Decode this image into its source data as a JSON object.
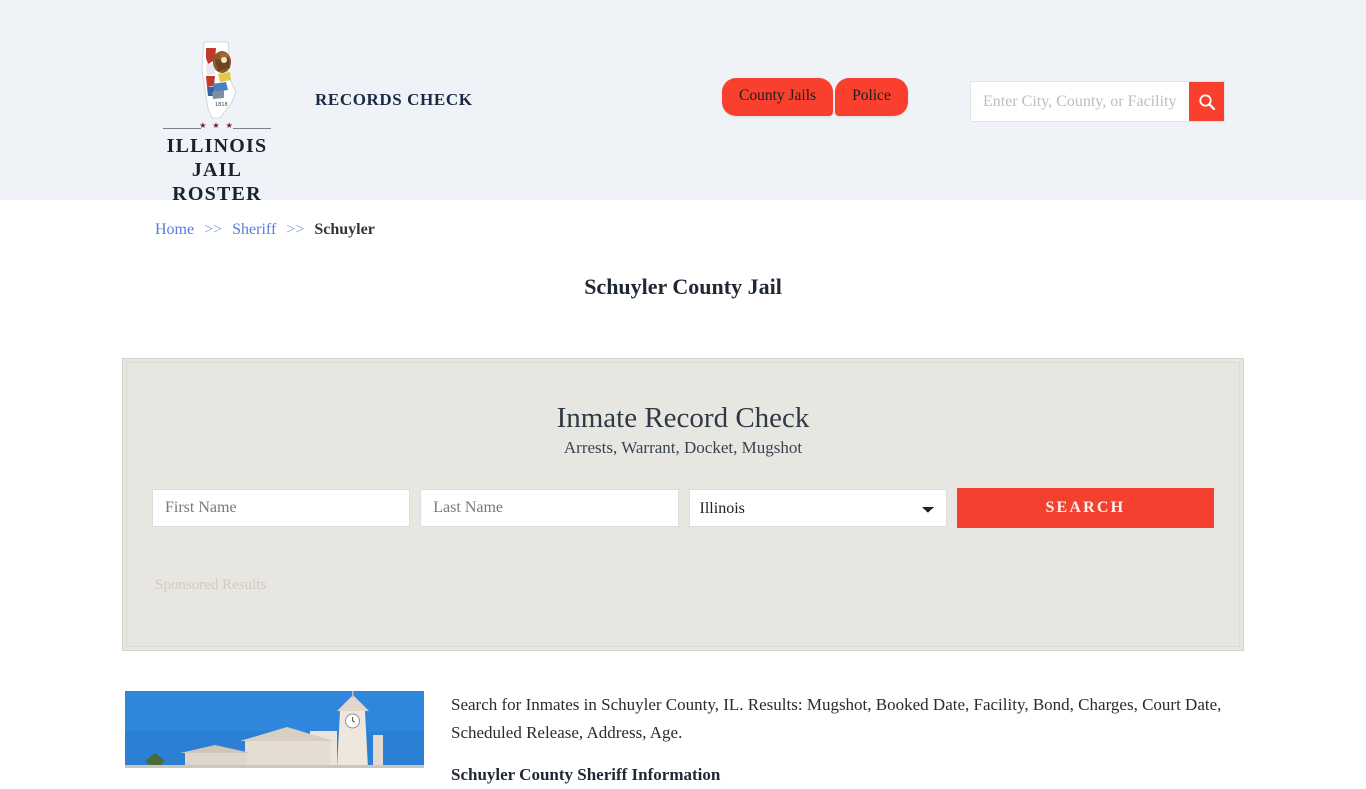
{
  "header": {
    "logo_state": "illinois-state-seal",
    "brand_line1": "ILLINOIS",
    "brand_line2": "JAIL ROSTER",
    "brand_divider_mark": "★ ★ ★",
    "tagline": "RECORDS CHECK",
    "nav": [
      {
        "label": "County Jails"
      },
      {
        "label": "Police"
      }
    ],
    "search": {
      "placeholder": "Enter City, County, or Facility",
      "value": "",
      "icon": "search-icon"
    }
  },
  "breadcrumb": {
    "items": [
      {
        "label": "Home",
        "link": true
      },
      {
        "label": "Sheriff",
        "link": true
      },
      {
        "label": "Schuyler",
        "link": false
      }
    ],
    "separator": ">>"
  },
  "page": {
    "title": "Schuyler County Jail"
  },
  "record_check": {
    "title": "Inmate Record Check",
    "subtitle": "Arrests, Warrant, Docket, Mugshot",
    "first_name_placeholder": "First Name",
    "first_name_value": "",
    "last_name_placeholder": "Last Name",
    "last_name_value": "",
    "state_selected": "Illinois",
    "state_options": [
      "Illinois"
    ],
    "search_button": "SEARCH",
    "sponsored_label": "Sponsored Results"
  },
  "content": {
    "thumbnail_alt": "schuyler-county-courthouse-photo",
    "description": "Search for Inmates in Schuyler County, IL. Results: Mugshot, Booked Date, Facility, Bond, Charges, Court Date, Scheduled Release, Address, Age.",
    "section_heading": "Schuyler County Sheriff Information"
  },
  "colors": {
    "accent_red": "#F9402E",
    "button_red": "#F4402E",
    "header_band": "#EFF3F8",
    "panel_bg": "#E8E6E1",
    "link_blue": "#5A7CD6",
    "title_dark": "#1F2833"
  }
}
